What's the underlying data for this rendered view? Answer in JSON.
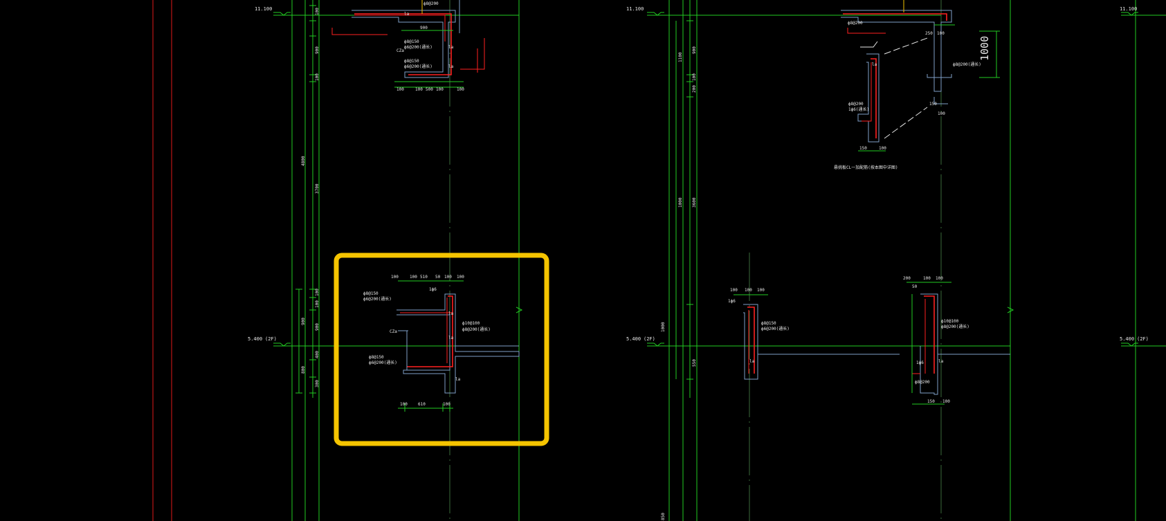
{
  "colors": {
    "background": "#000000",
    "axis": "#22cc22",
    "red_axis": "#e01818",
    "concrete": "#7f9fc8",
    "rebar": "#ff2020",
    "highlight": "#f5c400",
    "text": "#e8e8e8"
  },
  "levels": {
    "top_left": "11.100",
    "top_mid": "11.100",
    "top_right": "11.100",
    "mid_left": "5.400",
    "mid_left_floor": "(2F)",
    "mid_mid": "5.400",
    "mid_mid_floor": "(2F)",
    "mid_right": "5.400",
    "mid_right_floor": "(2F)"
  },
  "dims": {
    "col1": [
      "100",
      "900",
      "100",
      "4800",
      "3700",
      "100",
      "900",
      "100",
      "400",
      "800",
      "300",
      "900"
    ],
    "col2": [
      "1100",
      "900",
      "100",
      "200",
      "3600",
      "1000",
      "1000",
      "550",
      "850"
    ],
    "detail_a_top": [
      "100",
      "100",
      "510",
      "50",
      "100",
      "100"
    ],
    "detail_a_bottom": [
      "100",
      "610",
      "100"
    ],
    "top_detail_bottom": [
      "100",
      "100",
      "500",
      "100",
      "100"
    ],
    "top_detail_width": "900",
    "detail_c_top": [
      "100",
      "100",
      "100"
    ],
    "detail_d_top": [
      "200",
      "100",
      "100"
    ],
    "detail_d_sub": "50",
    "detail_d_bottom": [
      "150",
      "100"
    ],
    "upper_right_bottom": [
      "150",
      "100"
    ],
    "upper_right_side": [
      "250",
      "100"
    ],
    "upper_right_small": [
      "150",
      "100"
    ],
    "side_mark": "1000",
    "big_number": "1000"
  },
  "labels": {
    "la": "la",
    "cz": "CZa",
    "ls": "1ф6",
    "rebar_a1": "ф8@150",
    "rebar_a2": "ф6@200(通长)",
    "rebar_a3": "ф10@100",
    "rebar_a4": "ф8@200(通长)",
    "rebar_a5": "ф8@150",
    "rebar_a6": "ф6@200(通长)",
    "rebar_c1": "ф8@150",
    "rebar_c2": "ф6@200(通长)",
    "rebar_d1": "ф10@100",
    "rebar_d2": "ф8@200(通长)",
    "rebar_d3": "ф8@200",
    "rebar_t1": "ф8@150",
    "rebar_t2": "ф6@200(通长)",
    "rebar_t3": "ф8@150",
    "rebar_t4": "ф6@200(通长)",
    "rebar_t5": "ф8@200",
    "rebar_t6": "ф8@200",
    "rebar_u1": "ф8@200",
    "rebar_u2": "1ф6(通长)",
    "note_right": "ф8@200(通长)",
    "caption": "悬挑板CL一加配筋(按本图中详图)"
  }
}
